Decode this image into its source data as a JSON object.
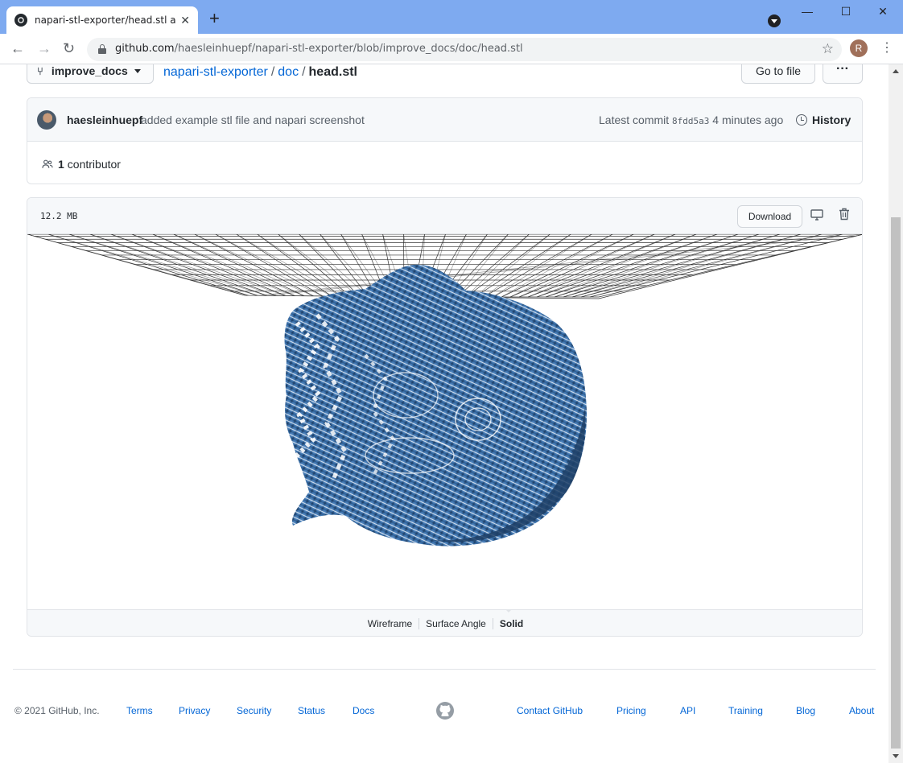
{
  "browser": {
    "tab_title": "napari-stl-exporter/head.stl at im",
    "url_host": "github.com",
    "url_path": "/haesleinhuepf/napari-stl-exporter/blob/improve_docs/doc/head.stl",
    "profile_initial": "R"
  },
  "repo": {
    "branch": "improve_docs",
    "crumb_repo": "napari-stl-exporter",
    "crumb_dir": "doc",
    "crumb_file": "head.stl",
    "go_to_file": "Go to file",
    "more": "···"
  },
  "commit": {
    "author": "haesleinhuepf",
    "message": "added example stl file and napari screenshot",
    "latest_label": "Latest commit",
    "sha": "8fdd5a3",
    "time": "4 minutes ago",
    "history": "History",
    "contributors_count": "1",
    "contributors_label": "contributor"
  },
  "file": {
    "size": "12.2 MB",
    "download": "Download",
    "modes": [
      "Wireframe",
      "Surface Angle",
      "Solid"
    ],
    "selected_mode": "Solid"
  },
  "footer": {
    "copyright": "© 2021 GitHub, Inc.",
    "links_left": [
      "Terms",
      "Privacy",
      "Security",
      "Status",
      "Docs"
    ],
    "links_right": [
      "Contact GitHub",
      "Pricing",
      "API",
      "Training",
      "Blog",
      "About"
    ]
  },
  "colors": {
    "link": "#0366d6",
    "model": "#3d73ad",
    "chrome": "#7eaaf0"
  }
}
